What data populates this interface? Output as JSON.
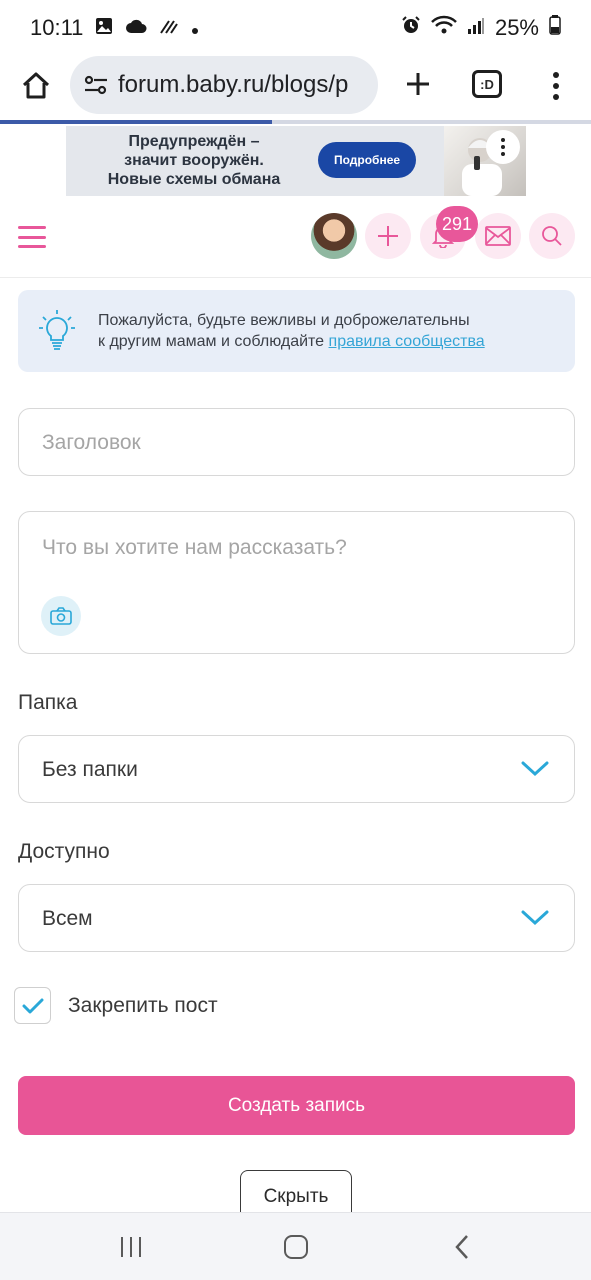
{
  "status_bar": {
    "time": "10:11",
    "battery": "25%",
    "icons": [
      "gallery-icon",
      "cloud-icon",
      "signal-activity-icon",
      "dot-icon",
      "alarm-icon",
      "wifi-icon",
      "cell-signal-icon",
      "battery-icon"
    ]
  },
  "browser": {
    "url": "forum.baby.ru/blogs/p",
    "tabs_label": ":D",
    "icons": [
      "home-icon",
      "site-settings-icon",
      "new-tab-icon",
      "tabs-icon",
      "more-vert-icon"
    ],
    "load_progress": 0.46
  },
  "ad": {
    "headline_line1": "Предупреждён –",
    "headline_line2": "значит вооружён.",
    "headline_line3": "Новые схемы обмана",
    "button_label": "Подробнее"
  },
  "header": {
    "notification_count": "291",
    "icons": [
      "menu-icon",
      "avatar",
      "add-icon",
      "bell-icon",
      "mail-icon",
      "search-icon"
    ]
  },
  "notice": {
    "text_line1": "Пожалуйста, будьте вежливы и доброжелательны",
    "text_line2_prefix": "к другим мамам и соблюдайте",
    "link_text": "правила сообщества"
  },
  "form": {
    "title_placeholder": "Заголовок",
    "body_placeholder": "Что вы хотите нам рассказать?",
    "folder_label": "Папка",
    "folder_value": "Без папки",
    "access_label": "Доступно",
    "access_value": "Всем",
    "pin_label": "Закрепить пост",
    "pin_checked": true,
    "submit_label": "Создать запись",
    "hide_label": "Скрыть"
  },
  "colors": {
    "brand_pink": "#e85596",
    "accent_blue": "#2aa8d8",
    "notice_bg": "#e8eef8"
  }
}
